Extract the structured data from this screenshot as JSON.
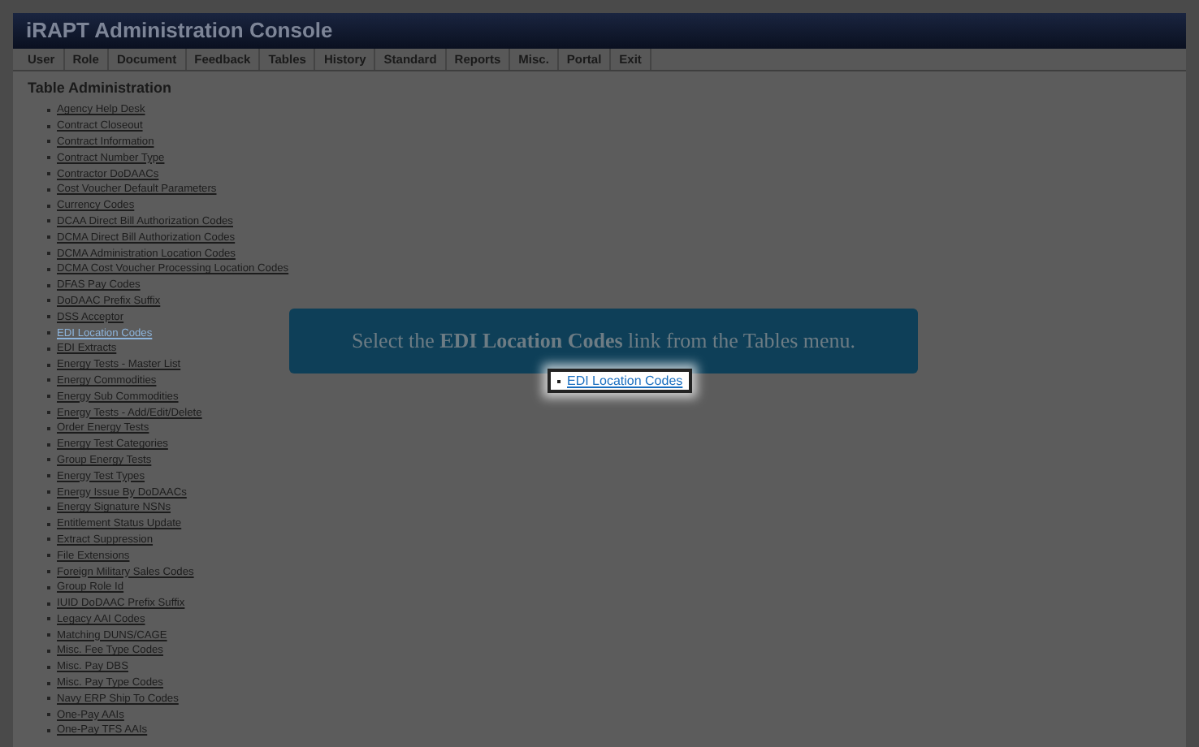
{
  "window": {
    "title": "iRAPT Administration Console"
  },
  "menu": [
    "User",
    "Role",
    "Document",
    "Feedback",
    "Tables",
    "History",
    "Standard",
    "Reports",
    "Misc.",
    "Portal",
    "Exit"
  ],
  "section_title": "Table Administration",
  "tables": [
    {
      "label": "Agency Help Desk",
      "selected": false
    },
    {
      "label": "Contract Closeout",
      "selected": false
    },
    {
      "label": "Contract Information",
      "selected": false
    },
    {
      "label": "Contract Number Type",
      "selected": false
    },
    {
      "label": "Contractor DoDAACs",
      "selected": false
    },
    {
      "label": "Cost Voucher Default Parameters",
      "selected": false
    },
    {
      "label": "Currency Codes",
      "selected": false
    },
    {
      "label": "DCAA Direct Bill Authorization Codes",
      "selected": false
    },
    {
      "label": "DCMA Direct Bill Authorization Codes",
      "selected": false
    },
    {
      "label": "DCMA Administration Location Codes",
      "selected": false
    },
    {
      "label": "DCMA Cost Voucher Processing Location Codes",
      "selected": false
    },
    {
      "label": "DFAS Pay Codes",
      "selected": false
    },
    {
      "label": "DoDAAC Prefix Suffix",
      "selected": false
    },
    {
      "label": "DSS Acceptor",
      "selected": false
    },
    {
      "label": "EDI Location Codes",
      "selected": true
    },
    {
      "label": "EDI Extracts",
      "selected": false
    },
    {
      "label": "Energy Tests - Master List",
      "selected": false
    },
    {
      "label": "Energy Commodities",
      "selected": false
    },
    {
      "label": "Energy Sub Commodities",
      "selected": false
    },
    {
      "label": "Energy Tests - Add/Edit/Delete",
      "selected": false
    },
    {
      "label": "Order Energy Tests",
      "selected": false
    },
    {
      "label": "Energy Test Categories",
      "selected": false
    },
    {
      "label": "Group Energy Tests",
      "selected": false
    },
    {
      "label": "Energy Test Types",
      "selected": false
    },
    {
      "label": "Energy Issue By DoDAACs",
      "selected": false
    },
    {
      "label": "Energy Signature NSNs",
      "selected": false
    },
    {
      "label": "Entitlement Status Update",
      "selected": false
    },
    {
      "label": "Extract Suppression",
      "selected": false
    },
    {
      "label": "File Extensions",
      "selected": false
    },
    {
      "label": "Foreign Military Sales Codes",
      "selected": false
    },
    {
      "label": "Group Role Id",
      "selected": false
    },
    {
      "label": "IUID DoDAAC Prefix Suffix",
      "selected": false
    },
    {
      "label": "Legacy AAI Codes",
      "selected": false
    },
    {
      "label": "Matching DUNS/CAGE",
      "selected": false
    },
    {
      "label": "Misc. Fee Type Codes",
      "selected": false
    },
    {
      "label": "Misc. Pay DBS",
      "selected": false
    },
    {
      "label": "Misc. Pay Type Codes",
      "selected": false
    },
    {
      "label": "Navy ERP Ship To Codes",
      "selected": false
    },
    {
      "label": "One-Pay AAIs",
      "selected": false
    },
    {
      "label": "One-Pay TFS AAIs",
      "selected": false
    }
  ],
  "callout": {
    "text": "Select the **EDI Location Codes** link from the Tables menu.",
    "target_link": "EDI Location Codes"
  }
}
